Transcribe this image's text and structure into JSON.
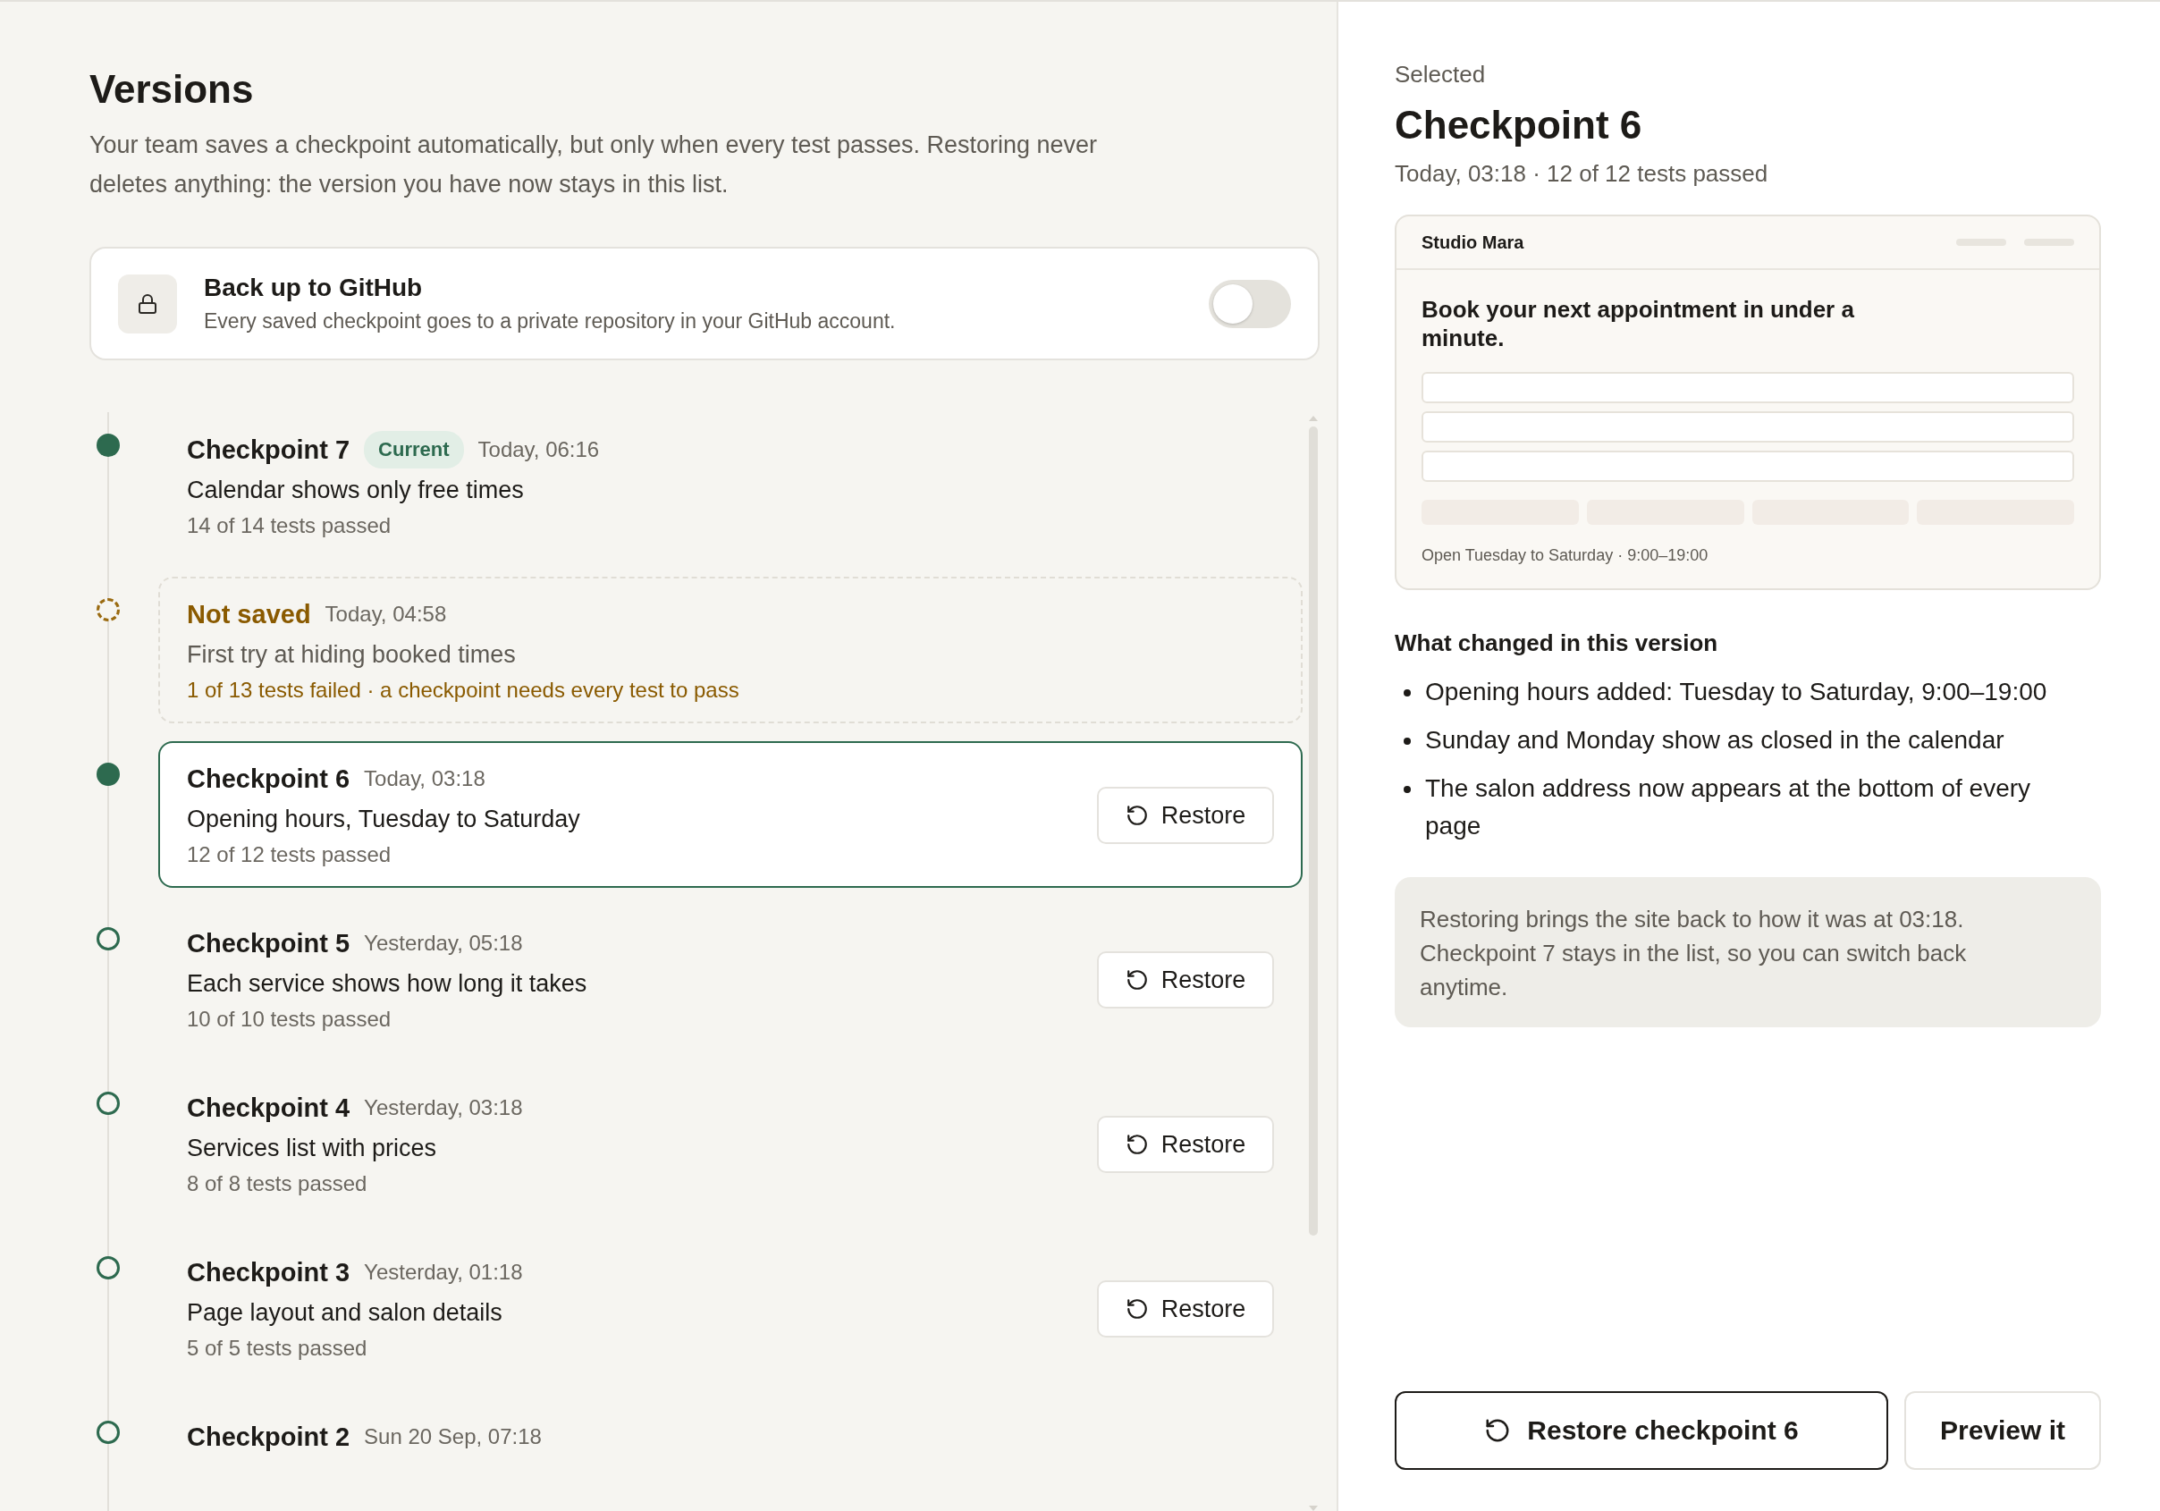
{
  "page": {
    "title": "Versions",
    "description": "Your team saves a checkpoint automatically, but only when every test passes. Restoring never deletes anything: the version you have now stays in this list."
  },
  "backup": {
    "title": "Back up to GitHub",
    "description": "Every saved checkpoint goes to a private repository in your GitHub account.",
    "on": false
  },
  "versions": [
    {
      "kind": "current",
      "title": "Checkpoint 7",
      "badge": "Current",
      "time": "Today, 06:16",
      "description": "Calendar shows only free times",
      "tests": "14 of 14 tests passed",
      "selected": false
    },
    {
      "kind": "unsaved",
      "title": "Not saved",
      "time": "Today, 04:58",
      "description": "First try at hiding booked times",
      "tests": "1 of 13 tests failed · a checkpoint needs every test to pass"
    },
    {
      "kind": "checkpoint",
      "title": "Checkpoint 6",
      "time": "Today, 03:18",
      "description": "Opening hours, Tuesday to Saturday",
      "tests": "12 of 12 tests passed",
      "selected": true,
      "action": "Restore"
    },
    {
      "kind": "checkpoint",
      "title": "Checkpoint 5",
      "time": "Yesterday, 05:18",
      "description": "Each service shows how long it takes",
      "tests": "10 of 10 tests passed",
      "selected": false,
      "action": "Restore"
    },
    {
      "kind": "checkpoint",
      "title": "Checkpoint 4",
      "time": "Yesterday, 03:18",
      "description": "Services list with prices",
      "tests": "8 of 8 tests passed",
      "selected": false,
      "action": "Restore"
    },
    {
      "kind": "checkpoint",
      "title": "Checkpoint 3",
      "time": "Yesterday, 01:18",
      "description": "Page layout and salon details",
      "tests": "5 of 5 tests passed",
      "selected": false,
      "action": "Restore"
    },
    {
      "kind": "checkpoint",
      "title": "Checkpoint 2",
      "time": "Sun 20 Sep, 07:18",
      "selected": false
    }
  ],
  "detail": {
    "label": "Selected",
    "title": "Checkpoint 6",
    "meta": "Today, 03:18 · 12 of 12 tests passed",
    "preview": {
      "brand": "Studio Mara",
      "heading": "Book your next appointment in under a minute.",
      "footer": "Open Tuesday to Saturday · 9:00–19:00"
    },
    "changes_title": "What changed in this version",
    "changes": [
      "Opening hours added: Tuesday to Saturday, 9:00–19:00",
      "Sunday and Monday show as closed in the calendar",
      "The salon address now appears at the bottom of every page"
    ],
    "note": "Restoring brings the site back to how it was at 03:18. Checkpoint 7 stays in the list, so you can switch back anytime.",
    "restore_button": "Restore checkpoint 6",
    "preview_button": "Preview it"
  }
}
